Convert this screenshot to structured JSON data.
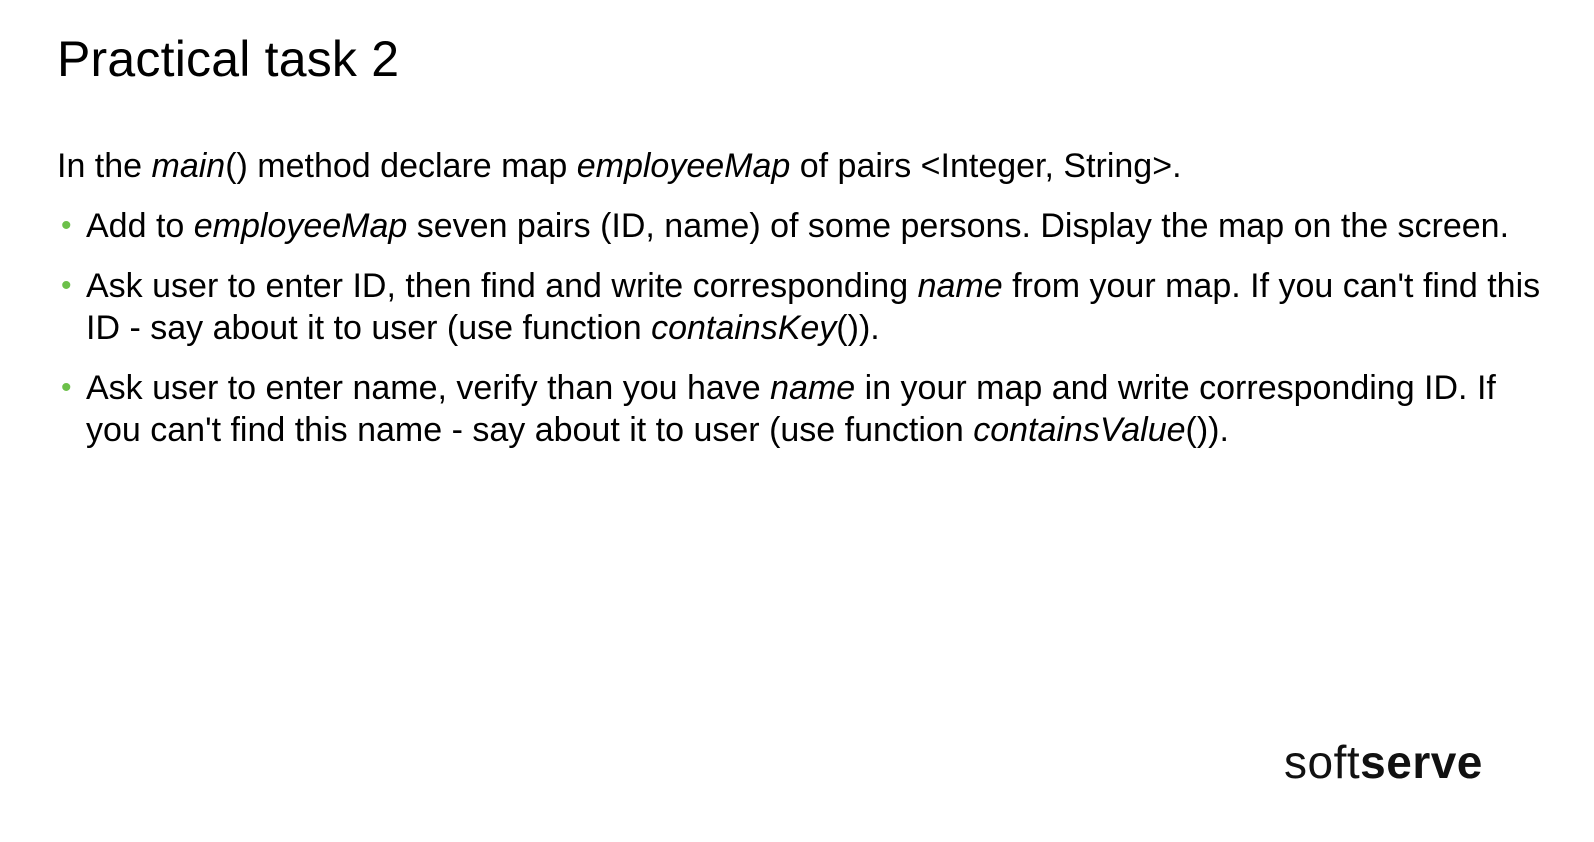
{
  "slide": {
    "title": "Practical task 2",
    "intro": {
      "t1": "In the ",
      "i1": "main",
      "t2": "() method declare map ",
      "i2": "employeeMap",
      "t3": " of pairs <Integer, String>."
    },
    "bullets": [
      {
        "t1": "Add to ",
        "i1": "employeeMap",
        "t2": " seven pairs (ID, name) of some persons. Display the map on the screen."
      },
      {
        "t1": "Ask user to enter ID, then find and write corresponding ",
        "i1": "name",
        "t2": " from your map. If you can't find this ID - say about it to user (use function ",
        "i2": "containsKey",
        "t3": "())."
      },
      {
        "t1": "Ask user to enter name, verify than you have ",
        "i1": "name",
        "t2": " in your map and write corresponding ID. If you can't find this name - say about it to user (use function ",
        "i2": "containsValue",
        "t3": "())."
      }
    ],
    "bullet_symbol": "•",
    "bullet_color": "#6cc04a",
    "logo": {
      "light": "soft",
      "bold": "serve"
    }
  }
}
